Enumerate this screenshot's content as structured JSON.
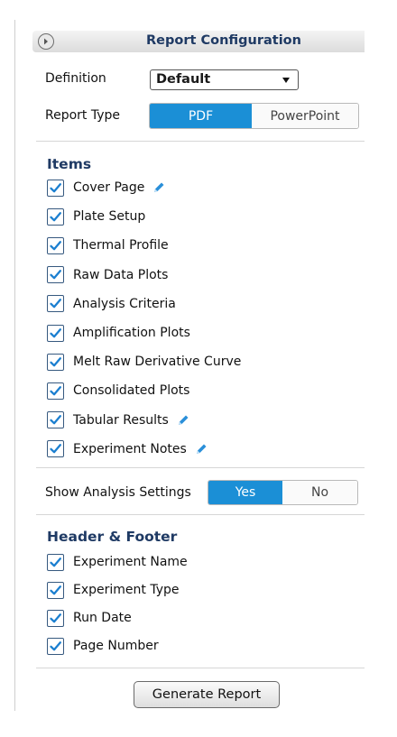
{
  "panel": {
    "title": "Report Configuration",
    "collapse_icon": "chevron-right-circle-icon"
  },
  "definition": {
    "label": "Definition",
    "selected": "Default"
  },
  "report_type": {
    "label": "Report Type",
    "options": [
      "PDF",
      "PowerPoint"
    ],
    "selected": "PDF"
  },
  "items": {
    "title": "Items",
    "list": [
      {
        "label": "Cover Page",
        "checked": true,
        "editable": true
      },
      {
        "label": "Plate Setup",
        "checked": true,
        "editable": false
      },
      {
        "label": "Thermal Profile",
        "checked": true,
        "editable": false
      },
      {
        "label": "Raw Data Plots",
        "checked": true,
        "editable": false
      },
      {
        "label": "Analysis Criteria",
        "checked": true,
        "editable": false
      },
      {
        "label": "Amplification Plots",
        "checked": true,
        "editable": false
      },
      {
        "label": "Melt Raw Derivative Curve",
        "checked": true,
        "editable": false
      },
      {
        "label": "Consolidated Plots",
        "checked": true,
        "editable": false
      },
      {
        "label": "Tabular Results",
        "checked": true,
        "editable": true
      },
      {
        "label": "Experiment Notes",
        "checked": true,
        "editable": true
      }
    ]
  },
  "show_analysis_settings": {
    "label": "Show Analysis Settings",
    "options": [
      "Yes",
      "No"
    ],
    "selected": "Yes"
  },
  "header_footer": {
    "title": "Header & Footer",
    "list": [
      {
        "label": "Experiment Name",
        "checked": true
      },
      {
        "label": "Experiment Type",
        "checked": true
      },
      {
        "label": "Run Date",
        "checked": true
      },
      {
        "label": "Page Number",
        "checked": true
      }
    ]
  },
  "actions": {
    "generate_label": "Generate Report"
  },
  "colors": {
    "accent": "#1b8fd6",
    "section_title": "#1f3a64",
    "check_mark": "#1b7fd0"
  }
}
